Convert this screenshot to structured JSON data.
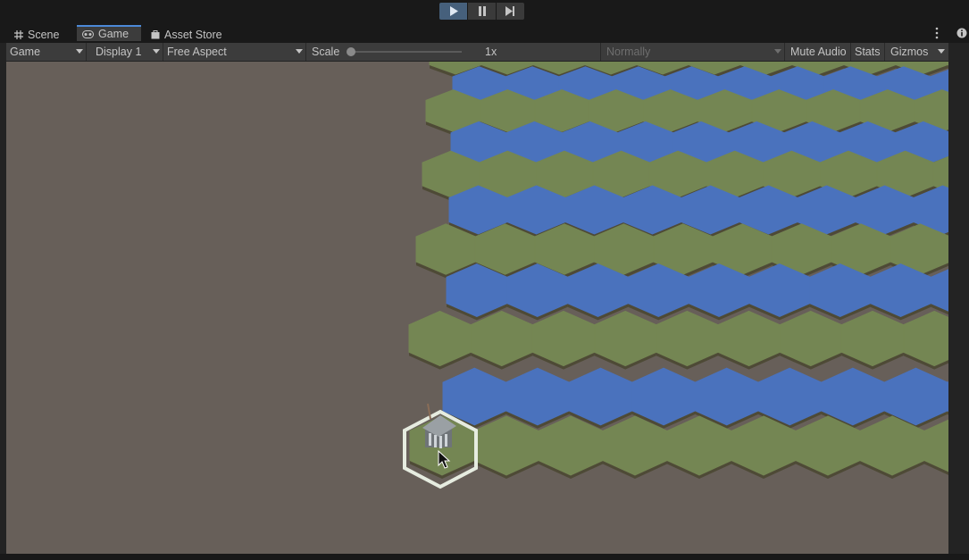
{
  "playmode": {
    "play_icon": "play-icon",
    "pause_icon": "pause-icon",
    "step_icon": "step-icon",
    "active": "play"
  },
  "tabs": [
    {
      "label": "Scene",
      "icon": "grid-icon"
    },
    {
      "label": "Game",
      "icon": "gamepad-icon",
      "active": true
    },
    {
      "label": "Asset Store",
      "icon": "bag-icon"
    }
  ],
  "toolbar": {
    "view_mode": "Game",
    "display": "Display 1",
    "aspect": "Free Aspect",
    "scale_label": "Scale",
    "scale_value": "1x",
    "vsync": "Normally",
    "mute_audio": "Mute Audio",
    "stats": "Stats",
    "gizmos": "Gizmos"
  },
  "colors": {
    "background": "#675f59",
    "grass": "#748653",
    "water": "#4a72bd",
    "accent": "#4c89d8"
  },
  "scene": {
    "objects": [
      "hex-grid-land",
      "hex-grid-water",
      "building-on-selected-tile",
      "mouse-cursor"
    ]
  }
}
